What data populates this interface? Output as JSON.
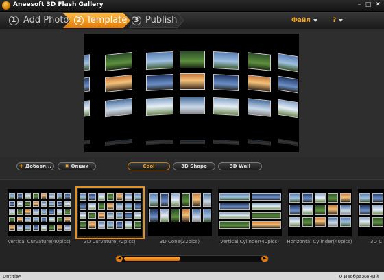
{
  "window": {
    "title": "Aneesoft 3D Flash Gallery"
  },
  "wizard": {
    "steps": [
      {
        "num": "1",
        "label": "Add Photo"
      },
      {
        "num": "2",
        "label": "Template"
      },
      {
        "num": "3",
        "label": "Publish"
      }
    ],
    "active_step": 1
  },
  "top_menu": {
    "file": "Файл",
    "help": "?"
  },
  "controls": {
    "add_button": "Добавл...",
    "options_button": "Опции",
    "categories": [
      "Cool",
      "3D Shape",
      "3D Wall"
    ],
    "selected_category": "Cool"
  },
  "templates": [
    {
      "label": "Vertical Curvature(40pics)"
    },
    {
      "label": "3D Curvature(72pics)",
      "selected": true
    },
    {
      "label": "3D Cone(32pics)"
    },
    {
      "label": "Vertical Cylinder(40pics)"
    },
    {
      "label": "Horizontal Cylinder(40pics)"
    },
    {
      "label": "3D C"
    }
  ],
  "status": {
    "file_name": "Untitle*",
    "image_count": "0 Изображений"
  },
  "colors": {
    "accent": "#f0a020",
    "background": "#2b2b2b"
  }
}
